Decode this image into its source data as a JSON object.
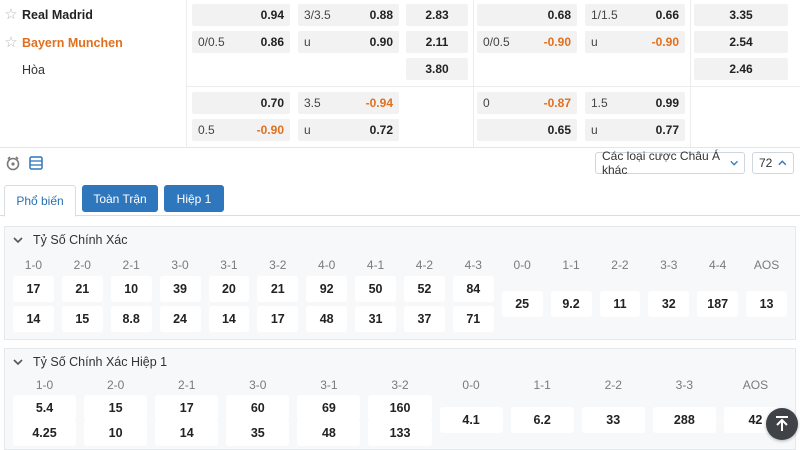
{
  "teams": {
    "home": "Real Madrid",
    "away": "Bayern Munchen",
    "draw": "Hòa"
  },
  "odds": {
    "ft_hdp": {
      "row1": {
        "line": "",
        "price": "0.94"
      },
      "row2": {
        "line": "0/0.5",
        "price": "0.86"
      }
    },
    "ft_ou": {
      "row1": {
        "line": "3/3.5",
        "price": "0.88"
      },
      "row2": {
        "line": "u",
        "price": "0.90"
      }
    },
    "ft_1x2": [
      "2.83",
      "2.11",
      "3.80"
    ],
    "h1_hdp": {
      "row1": {
        "line": "",
        "price": "0.68"
      },
      "row2": {
        "line": "0/0.5",
        "price": "-0.90"
      }
    },
    "h1_ou": {
      "row1": {
        "line": "1/1.5",
        "price": "0.66"
      },
      "row2": {
        "line": "u",
        "price": "-0.90"
      }
    },
    "h1_1x2": [
      "3.35",
      "2.54",
      "2.46"
    ],
    "alt_ft_hdp": {
      "row1": {
        "line": "",
        "price": "0.70"
      },
      "row2": {
        "line": "0.5",
        "price": "-0.90"
      }
    },
    "alt_ft_ou": {
      "row1": {
        "line": "3.5",
        "price": "-0.94"
      },
      "row2": {
        "line": "u",
        "price": "0.72"
      }
    },
    "alt_h1_hdp": {
      "row1": {
        "line": "0",
        "price": "-0.87"
      },
      "row2": {
        "line": "",
        "price": "0.65"
      }
    },
    "alt_h1_ou": {
      "row1": {
        "line": "1.5",
        "price": "0.99"
      },
      "row2": {
        "line": "u",
        "price": "0.77"
      }
    }
  },
  "toolbar": {
    "market_select": "Các loại cược Châu Á khác",
    "count_select": "72"
  },
  "tabs": {
    "popular": "Phổ biến",
    "full_match": "Toàn Trận",
    "half1": "Hiệp 1"
  },
  "section1": {
    "title": "Tỷ Số Chính Xác",
    "home_scores": [
      "1-0",
      "2-0",
      "2-1",
      "3-0",
      "3-1",
      "3-2",
      "4-0",
      "4-1",
      "4-2",
      "4-3"
    ],
    "home_odds": [
      "17",
      "21",
      "10",
      "39",
      "20",
      "21",
      "92",
      "50",
      "52",
      "84"
    ],
    "away_odds": [
      "14",
      "15",
      "8.8",
      "24",
      "14",
      "17",
      "48",
      "31",
      "37",
      "71"
    ],
    "draw_scores": [
      "0-0",
      "1-1",
      "2-2",
      "3-3",
      "4-4",
      "AOS"
    ],
    "draw_odds": [
      "25",
      "9.2",
      "11",
      "32",
      "187",
      "13"
    ]
  },
  "section2": {
    "title": "Tỷ Số Chính Xác Hiệp 1",
    "home_scores": [
      "1-0",
      "2-0",
      "2-1",
      "3-0",
      "3-1",
      "3-2"
    ],
    "home_odds": [
      "5.4",
      "15",
      "17",
      "60",
      "69",
      "160"
    ],
    "away_odds": [
      "4.25",
      "10",
      "14",
      "35",
      "48",
      "133"
    ],
    "draw_scores": [
      "0-0",
      "1-1",
      "2-2",
      "3-3",
      "AOS"
    ],
    "draw_odds": [
      "4.1",
      "6.2",
      "33",
      "288",
      "42"
    ]
  },
  "icons": {
    "fav": "star-icon",
    "stats": "stats-icon",
    "list": "list-icon",
    "scroll_top": "arrow-up-icon"
  },
  "colors": {
    "accent": "#2f77bd",
    "away_team": "#e0701e",
    "negative_price": "#e0701e"
  }
}
